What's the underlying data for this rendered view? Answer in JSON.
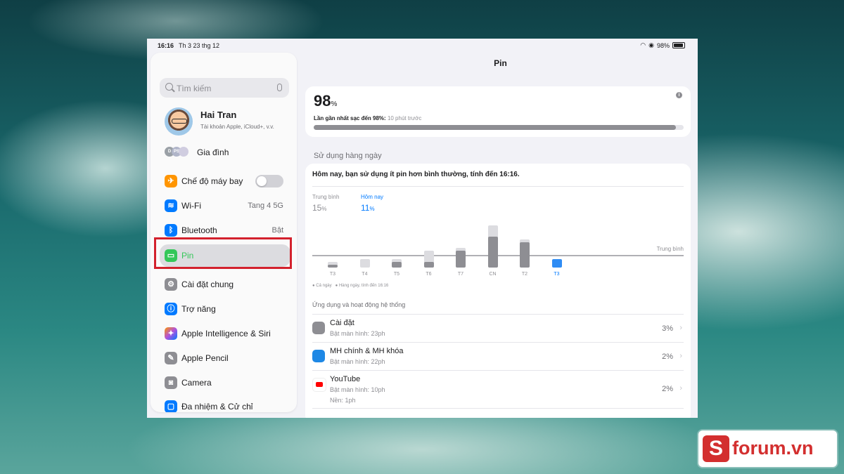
{
  "status_bar": {
    "time": "16:16",
    "date": "Th 3 23 thg 12",
    "battery": "98%"
  },
  "sidebar": {
    "search_placeholder": "Tìm kiếm",
    "profile": {
      "name": "Hai Tran",
      "subtitle": "Tài khoản Apple, iCloud+, v.v."
    },
    "family": {
      "label": "Gia đình",
      "avatars": [
        "D",
        "PS"
      ]
    },
    "items": [
      {
        "label": "Chế độ máy bay",
        "value": "",
        "icon": "airplane-icon",
        "color": "#ff9500"
      },
      {
        "label": "Wi-Fi",
        "value": "Tang 4 5G",
        "icon": "wifi-icon",
        "color": "#007aff"
      },
      {
        "label": "Bluetooth",
        "value": "Bật",
        "icon": "bluetooth-icon",
        "color": "#007aff"
      },
      {
        "label": "Pin",
        "value": "",
        "icon": "battery-icon",
        "color": "#34c759"
      },
      {
        "label": "Cài đặt chung",
        "value": "",
        "icon": "gear-icon",
        "color": "#8e8e93"
      },
      {
        "label": "Trợ năng",
        "value": "",
        "icon": "accessibility-icon",
        "color": "#007aff"
      },
      {
        "label": "Apple Intelligence & Siri",
        "value": "",
        "icon": "siri-icon",
        "color": "#af52de"
      },
      {
        "label": "Apple Pencil",
        "value": "",
        "icon": "pencil-icon",
        "color": "#8e8e93"
      },
      {
        "label": "Camera",
        "value": "",
        "icon": "camera-icon",
        "color": "#8e8e93"
      },
      {
        "label": "Đa nhiệm & Cử chỉ",
        "value": "",
        "icon": "multitasking-icon",
        "color": "#007aff"
      }
    ]
  },
  "main": {
    "title": "Pin",
    "battery_level": {
      "value": "98",
      "unit": "%",
      "fill": 0.98
    },
    "last_charged": {
      "label": "Lần gần nhất sạc đến 98%:",
      "time": "10 phút trước"
    },
    "daily_usage_header": "Sử dụng hàng ngày",
    "summary": "Hôm nay, bạn sử dụng ít pin hơn bình thường, tính đến 16:16.",
    "average": {
      "label": "Trung bình",
      "value": "15",
      "unit": "%"
    },
    "today": {
      "label": "Hôm nay",
      "value": "11",
      "unit": "%"
    },
    "average_line_label": "Trung bình",
    "legend": {
      "all_day": "Cả ngày",
      "hourly": "Hàng ngày, tính đến 16:16"
    },
    "apps_header": "Ứng dụng và hoạt động hệ thống",
    "apps": [
      {
        "name": "Cài đặt",
        "detail": "Bật màn hình: 23ph",
        "detail2": "",
        "percent": "3%",
        "icon": "settings-app-icon",
        "color": "#8e8e93"
      },
      {
        "name": "MH chính & MH khóa",
        "detail": "Bật màn hình: 22ph",
        "detail2": "",
        "percent": "2%",
        "icon": "home-lock-screen-icon",
        "color": "#1e88e5"
      },
      {
        "name": "YouTube",
        "detail": "Bật màn hình: 10ph",
        "detail2": "Nền: 1ph",
        "percent": "2%",
        "icon": "youtube-icon",
        "color": "#ff0000"
      }
    ]
  },
  "chart_data": {
    "type": "bar",
    "categories": [
      "T3",
      "T4",
      "T5",
      "T6",
      "T7",
      "CN",
      "T2",
      "T3"
    ],
    "series": [
      {
        "name": "Cả ngày",
        "values": [
          2,
          3,
          3,
          6,
          7,
          15,
          10,
          3
        ]
      },
      {
        "name": "Hàng ngày, tính đến 16:16",
        "values": [
          1,
          0,
          2,
          2,
          6,
          11,
          9,
          3
        ]
      }
    ],
    "average": 5,
    "highlight_index": 7,
    "ylim": [
      0,
      15
    ]
  },
  "watermark": {
    "text": "forum.vn",
    "letter": "S"
  }
}
